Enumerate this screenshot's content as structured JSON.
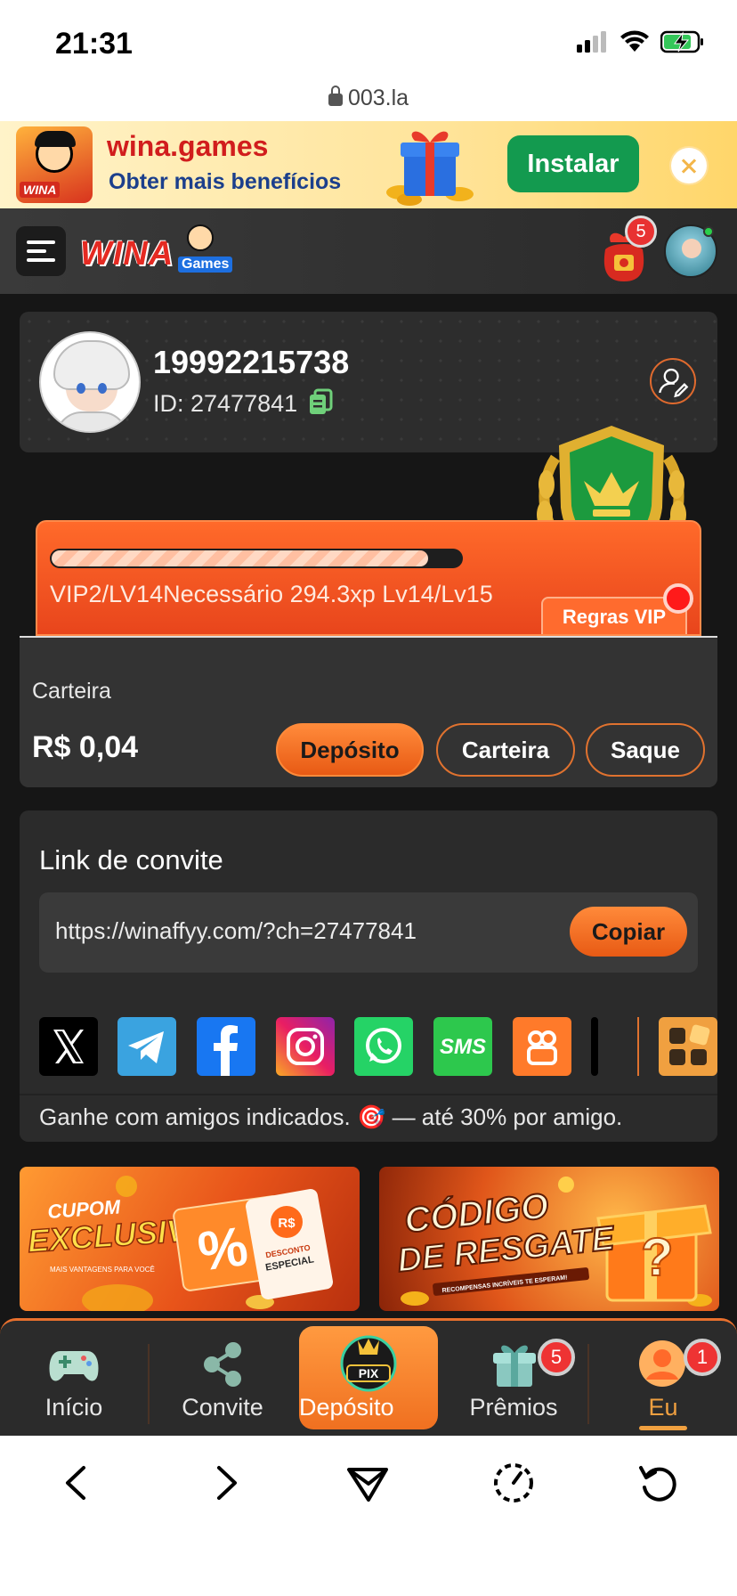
{
  "status_bar": {
    "time": "21:31"
  },
  "browser": {
    "url": "003.la"
  },
  "install_banner": {
    "title": "wina.games",
    "subtitle": "Obter mais benefícios",
    "install_label": "Instalar",
    "logo_text": "WINA"
  },
  "header": {
    "logo_text": "WINA",
    "logo_sub": "Games",
    "notification_count": "5"
  },
  "profile": {
    "name": "19992215738",
    "id_text": "ID: 27477841"
  },
  "vip": {
    "progress_text": "VIP2/LV14Necessário 294.3xp Lv14/Lv15",
    "progress_fraction": 0.92,
    "rules_label": "Regras VIP"
  },
  "wallet": {
    "label": "Carteira",
    "amount": "R$ 0,04",
    "buttons": {
      "deposit": "Depósito",
      "wallet": "Carteira",
      "withdraw": "Saque"
    }
  },
  "invite": {
    "title": "Link de convite",
    "url": "https://winaffyy.com/?ch=27477841",
    "copy_label": "Copiar",
    "share_targets": [
      "x-icon",
      "telegram-icon",
      "facebook-icon",
      "instagram-icon",
      "whatsapp-icon",
      "sms-icon",
      "kwai-icon",
      "more-apps-icon"
    ],
    "sms_label": "SMS",
    "note": "Ganhe com amigos indicados. 🎯 — até 30% por amigo."
  },
  "promos": {
    "left": {
      "line1": "CUPOM",
      "line2": "EXCLUSIVO",
      "tagline": "MAIS VANTAGENS PARA VOCÊ",
      "ticket_currency": "R$",
      "ticket_line1": "DESCONTO",
      "ticket_line2": "ESPECIAL",
      "percent": "%"
    },
    "right": {
      "line1": "CÓDIGO",
      "line2": "DE RESGATE",
      "tagline": "RECOMPENSAS INCRÍVEIS TE ESPERAM!",
      "mark": "?"
    }
  },
  "bottom_nav": {
    "items": [
      {
        "label": "Início"
      },
      {
        "label": "Convite"
      },
      {
        "label": "Depósito",
        "icon_text": "PIX"
      },
      {
        "label": "Prêmios",
        "badge": "5"
      },
      {
        "label": "Eu",
        "badge": "1"
      }
    ]
  },
  "colors": {
    "accent": "#e8702e",
    "background": "#161616",
    "card": "#2d2d2d",
    "install_green": "#139a4f"
  }
}
